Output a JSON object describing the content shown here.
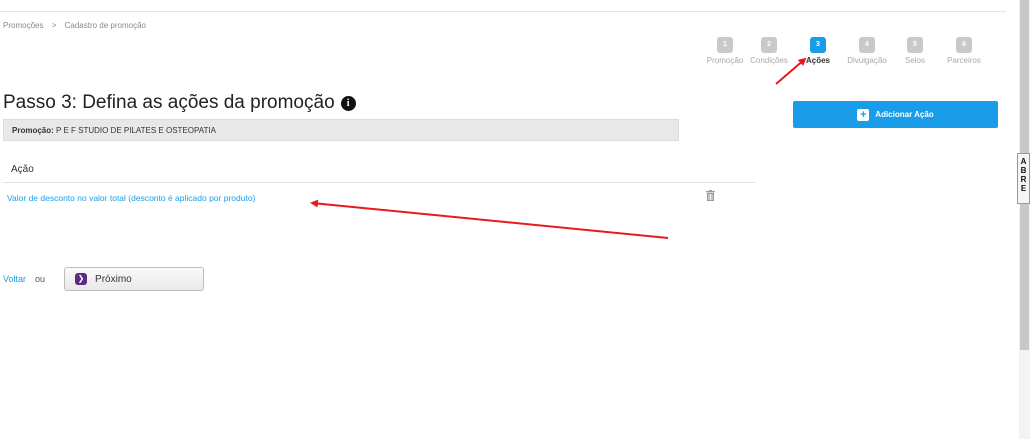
{
  "breadcrumb": {
    "item1": "Promoções",
    "sep": ">",
    "item2": "Cadastro de promoção"
  },
  "steps": [
    {
      "num": "1",
      "label": "Promoção"
    },
    {
      "num": "2",
      "label": "Condições"
    },
    {
      "num": "3",
      "label": "Ações"
    },
    {
      "num": "4",
      "label": "Divulgação"
    },
    {
      "num": "5",
      "label": "Selos"
    },
    {
      "num": "6",
      "label": "Parceiros"
    }
  ],
  "active_step": 3,
  "page": {
    "title": "Passo 3: Defina as ações da promoção",
    "info_icon": "i"
  },
  "promo": {
    "label": "Promoção:",
    "name": "P E F STUDIO DE PILATES E OSTEOPATIA"
  },
  "add_button": {
    "icon": "+",
    "label": "Adicionar Ação"
  },
  "table": {
    "header": "Ação",
    "rows": [
      {
        "action": "Valor de desconto no valor total (desconto é aplicado por produto)"
      }
    ]
  },
  "nav": {
    "back": "Voltar",
    "or": "ou",
    "next": "Próximo",
    "next_icon": "❯"
  },
  "side_tab": [
    "A",
    "B",
    "R",
    "E"
  ],
  "colors": {
    "accent": "#1a9de8",
    "arrow": "#e8191c",
    "next_icon_bg": "#5b2c83"
  }
}
